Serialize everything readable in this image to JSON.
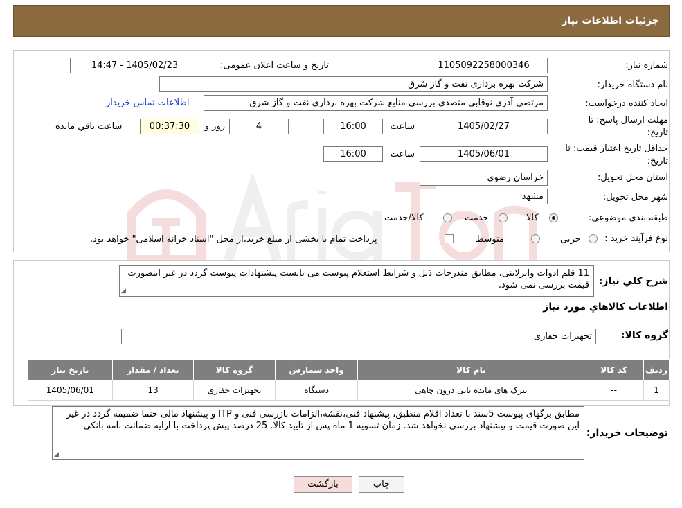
{
  "header": {
    "title": "جزئیات اطلاعات نیاز"
  },
  "form": {
    "need_number_label": "شماره نیاز:",
    "need_number": "1105092258000346",
    "announce_label": "تاریخ و ساعت اعلان عمومی:",
    "announce_value": "1405/02/23 - 14:47",
    "buyer_org_label": "نام دستگاه خریدار:",
    "buyer_org": "شرکت بهره برداری نفت و گاز شرق",
    "creator_label": "ایجاد کننده درخواست:",
    "creator": "مرتضی آذری نوقابی متصدی بررسی منابع شرکت بهره برداری نفت و گاز شرق",
    "contact_link": "اطلاعات تماس خریدار",
    "deadline_label_1": "مهلت ارسال پاسخ: تا",
    "deadline_label_2": "تاریخ:",
    "deadline_date": "1405/02/27",
    "time_label": "ساعت",
    "deadline_time": "16:00",
    "days_value": "4",
    "days_label": "روز و",
    "remaining_time": "00:37:30",
    "remaining_label": "ساعت باقي مانده",
    "validity_label_1": "حداقل تاریخ اعتبار قیمت: تا",
    "validity_label_2": "تاریخ:",
    "validity_date": "1405/06/01",
    "validity_time": "16:00",
    "province_label": "استان محل تحویل:",
    "province": "خراسان رضوی",
    "city_label": "شهر محل تحویل:",
    "city": "مشهد",
    "category_label": "طبقه بندی موضوعی:",
    "category_options": [
      "کالا",
      "خدمت",
      "کالا/خدمت"
    ],
    "purchase_type_label": "نوع فرآیند خرید :",
    "purchase_options": [
      "جزیی",
      "متوسط"
    ],
    "purchase_note": "پرداخت تمام یا بخشی از مبلغ خرید،از محل \"اسناد خزانه اسلامی\" خواهد بود."
  },
  "summary": {
    "label": "شرح كلي نياز:",
    "text": "11 قلم ادوات وایرلاینی، مطابق مندرجات ذیل و شرایط استعلام پیوست می بایست پیشنهادات پیوست گردد در غیر اینصورت قیمت بررسی نمی شود.",
    "goods_info_title": "اطلاعات كالاهاي مورد نياز",
    "goods_group_label": "گروه کالا:",
    "goods_group": "تجهیزات حفاری"
  },
  "table": {
    "headers": [
      "ردیف",
      "کد کالا",
      "نام کالا",
      "واحد شمارش",
      "گروه کالا",
      "تعداد / مقدار",
      "تاریخ نیاز"
    ],
    "rows": [
      [
        "1",
        "--",
        "تیرک های مانده یابی درون چاهی",
        "دستگاه",
        "تجهیزات حفاری",
        "13",
        "1405/06/01"
      ]
    ]
  },
  "buyer_notes": {
    "label": "توضیحات خریدار:",
    "text": "مطابق برگهای پیوست 5سند با تعداد اقلام منطبق، پیشنهاد فنی،نقشه،الزامات بازرسی فنی و ITP و پیشنهاد مالی حتما ضمیمه گردد در غیر این صورت قیمت و پیشنهاد بررسی نخواهد شد. زمان تسویه 1 ماه پس از تایید کالا. 25 درصد پیش پرداخت با ارایه ضمانت نامه بانکی"
  },
  "buttons": {
    "print": "چاپ",
    "back": "بازگشت"
  },
  "colors": {
    "header_bg": "#8b6a40",
    "table_header_bg": "#7f7f7f",
    "back_button_bg": "#f7dcdc",
    "timer_bg": "#ffffe0"
  }
}
